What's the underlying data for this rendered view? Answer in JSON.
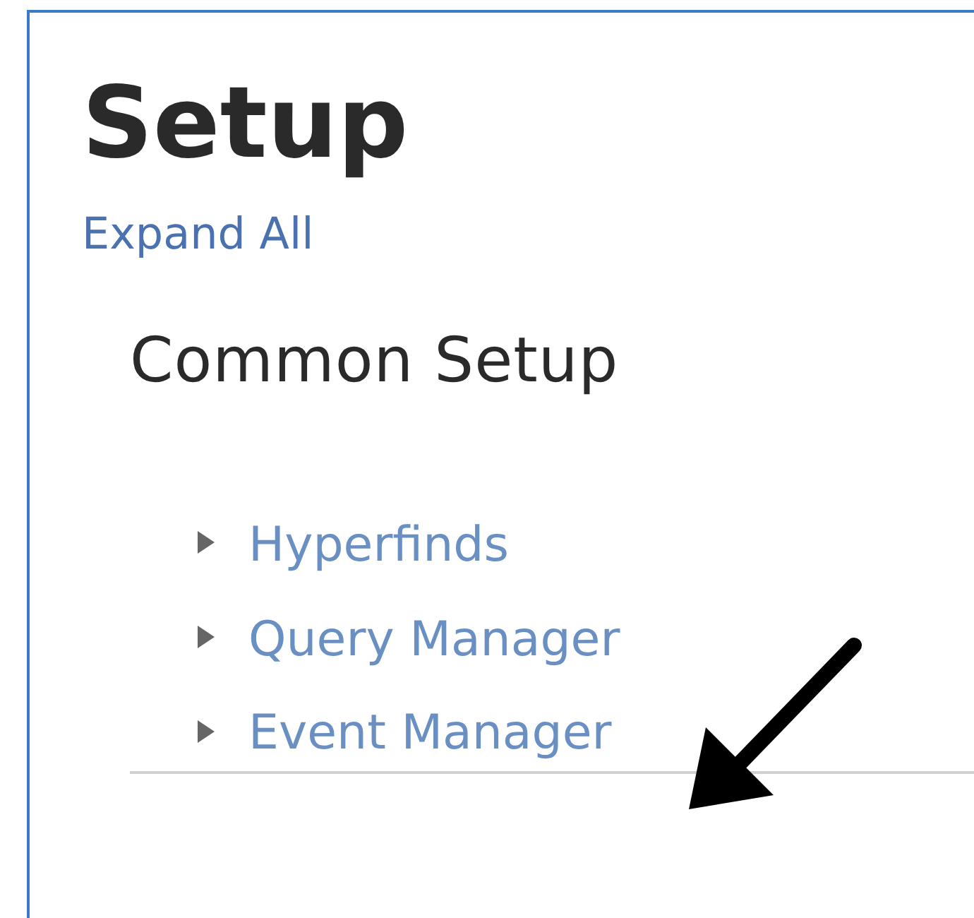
{
  "page": {
    "title": "Setup",
    "expand_link": "Expand All"
  },
  "section": {
    "title": "Common Setup",
    "items": [
      {
        "label": "Hyperfinds",
        "expanded": false
      },
      {
        "label": "Query Manager",
        "expanded": false
      },
      {
        "label": "Event Manager",
        "expanded": false
      }
    ]
  },
  "annotation": {
    "kind": "arrow"
  }
}
